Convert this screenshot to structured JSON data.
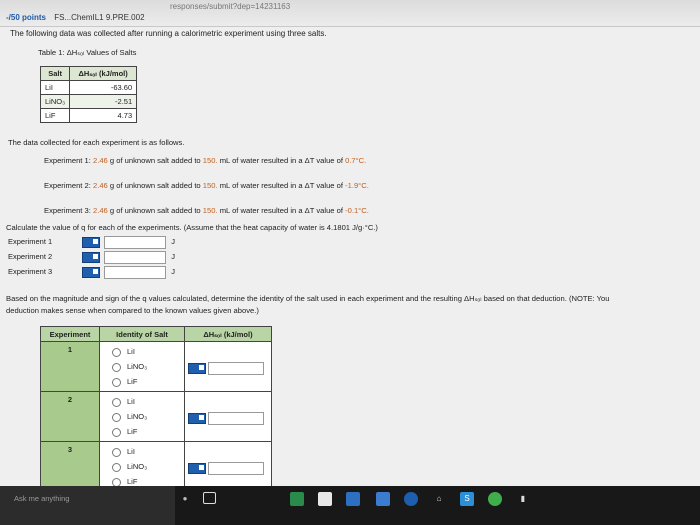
{
  "browser": {
    "url_fragment": "responses/submit?dep=14231163"
  },
  "header": {
    "points": "-/50 points",
    "course": "FS...ChemIL1 9.PRE.002"
  },
  "question": {
    "intro": "The following data was collected after running a calorimetric experiment using three salts.",
    "table_caption": "Table 1: ΔHₛₒₗ Values of Salts",
    "table_headers": [
      "Salt",
      "ΔHₛₒₗ (kJ/mol)"
    ],
    "table_rows": [
      [
        "LiI",
        "-63.60"
      ],
      [
        "LiNO₃",
        "-2.51"
      ],
      [
        "LiF",
        "4.73"
      ]
    ],
    "data_intro": "The data collected for each experiment is as follows.",
    "experiments": [
      {
        "label": "Experiment 1:",
        "mass": "2.46",
        "text1": "g of unknown salt added to",
        "vol": "150.",
        "text2": "mL of water resulted in a ΔT value of",
        "dt": "0.7°C."
      },
      {
        "label": "Experiment 2:",
        "mass": "2.46",
        "text1": "g of unknown salt added to",
        "vol": "150.",
        "text2": "mL of water resulted in a ΔT value of",
        "dt": "-1.9°C."
      },
      {
        "label": "Experiment 3:",
        "mass": "2.46",
        "text1": "g of unknown salt added to",
        "vol": "150.",
        "text2": "mL of water resulted in a ΔT value of",
        "dt": "-0.1°C."
      }
    ],
    "calc_prompt": "Calculate the value of q for each of the experiments. (Assume that the heat capacity of water is 4.1801 J/g·°C.)",
    "answer_rows": [
      {
        "label": "Experiment 1",
        "unit": "J"
      },
      {
        "label": "Experiment 2",
        "unit": "J"
      },
      {
        "label": "Experiment 3",
        "unit": "J"
      }
    ],
    "identity_prompt_line1": "Based on the magnitude and sign of the q values calculated, determine the identity of the salt used in each experiment and the resulting ΔHₛₒₗ based on that deduction. (NOTE: You",
    "identity_prompt_line2": "deduction makes sense when compared to the known values given above.)",
    "table2_headers": [
      "Experiment",
      "Identity of Salt",
      "ΔHₛₒₗ (kJ/mol)"
    ],
    "table2_rows": [
      {
        "num": "1",
        "options": [
          "LiI",
          "LiNO₃",
          "LiF"
        ]
      },
      {
        "num": "2",
        "options": [
          "LiI",
          "LiNO₃",
          "LiF"
        ]
      },
      {
        "num": "3",
        "options": [
          "LiI",
          "LiNO₃",
          "LiF"
        ]
      }
    ]
  },
  "taskbar": {
    "search_placeholder": "Ask me anything"
  }
}
